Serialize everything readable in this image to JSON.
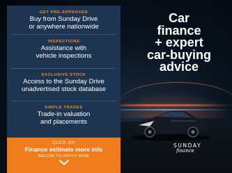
{
  "features": [
    {
      "title": "GET PRE-APPROVED",
      "text_line1": "Buy from Sunday Drive",
      "text_line2": "or anywhere nationwide"
    },
    {
      "title": "INSPECTIONS",
      "text_line1": "Assistance with",
      "text_line2": "vehicle inspections"
    },
    {
      "title": "EXCLUSIVE STOCK",
      "text_line1": "Access to the Sunday Drive",
      "text_line2": "unadvertised stock database"
    },
    {
      "title": "SIMPLE TRADES",
      "text_line1": "Trade-in valuation",
      "text_line2": "and placements"
    }
  ],
  "cta": {
    "kicker": "CLICK ON",
    "main": "Finance estimate more info",
    "sub": "BELOW TO APPLY NOW",
    "icon": "chevron-down-icon"
  },
  "headline": {
    "line1": "Car",
    "line2": "finance",
    "line3": "+ expert",
    "line4": "car-buying",
    "line5": "advice"
  },
  "logo": {
    "word": "SUNDAY",
    "sub": "finance"
  },
  "colors": {
    "panel": "#1e3552",
    "accent": "#f07d1c",
    "feature_title": "#f08a24"
  }
}
